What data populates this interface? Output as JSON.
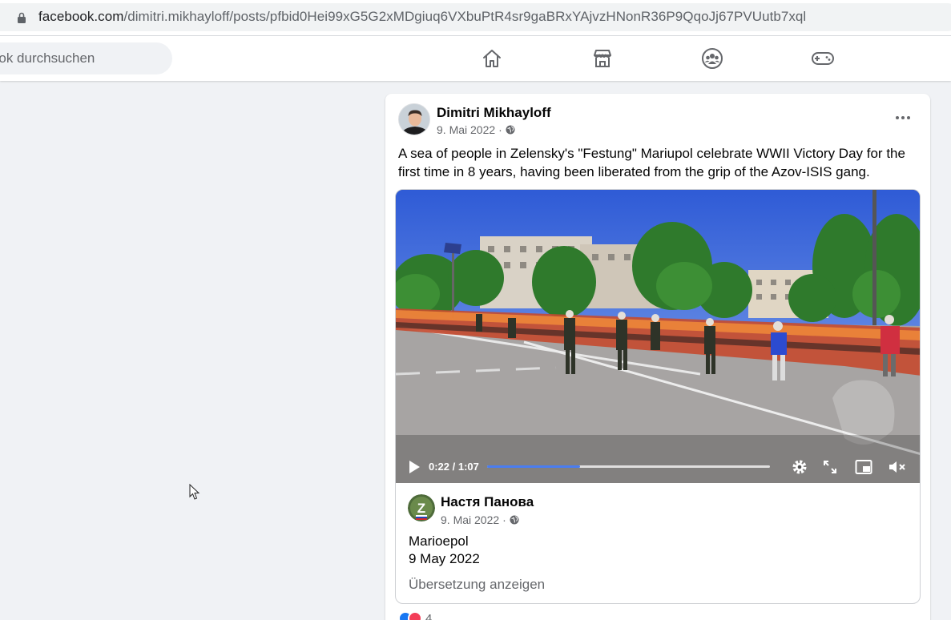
{
  "browser": {
    "url_host": "facebook.com",
    "url_path": "/dimitri.mikhayloff/posts/pfbid0Hei99xG5G2xMDgiuq6VXbuPtR4sr9gaBRxYAjvzHNonR36P9QqoJj67PVUutb7xql"
  },
  "header": {
    "search_placeholder": "ebook durchsuchen",
    "nav": [
      "home-icon",
      "marketplace-icon",
      "groups-icon",
      "gaming-icon"
    ]
  },
  "post": {
    "author": "Dimitri Mikhayloff",
    "date": "9. Mai 2022",
    "date_separator": "·",
    "text": "A sea of people in Zelensky's \"Festung\" Mariupol celebrate WWII Victory Day for the first time in 8 years, having been liberated from the grip of the Azov-ISIS gang.",
    "video": {
      "current_time": "0:22",
      "duration": "1:07",
      "time_display": "0:22 / 1:07",
      "progress_fraction": 0.328
    },
    "shared": {
      "author": "Настя Панова",
      "avatar_letter": "Z",
      "date": "9. Mai 2022",
      "date_separator": "·",
      "line1": "Marioepol",
      "line2": "9 May 2022",
      "translate_label": "Übersetzung anzeigen"
    },
    "reaction_count": "4"
  },
  "colors": {
    "accent": "#1877f2",
    "progress": "#4a7df0",
    "secondary_text": "#65676b",
    "page_bg": "#f0f2f5"
  }
}
